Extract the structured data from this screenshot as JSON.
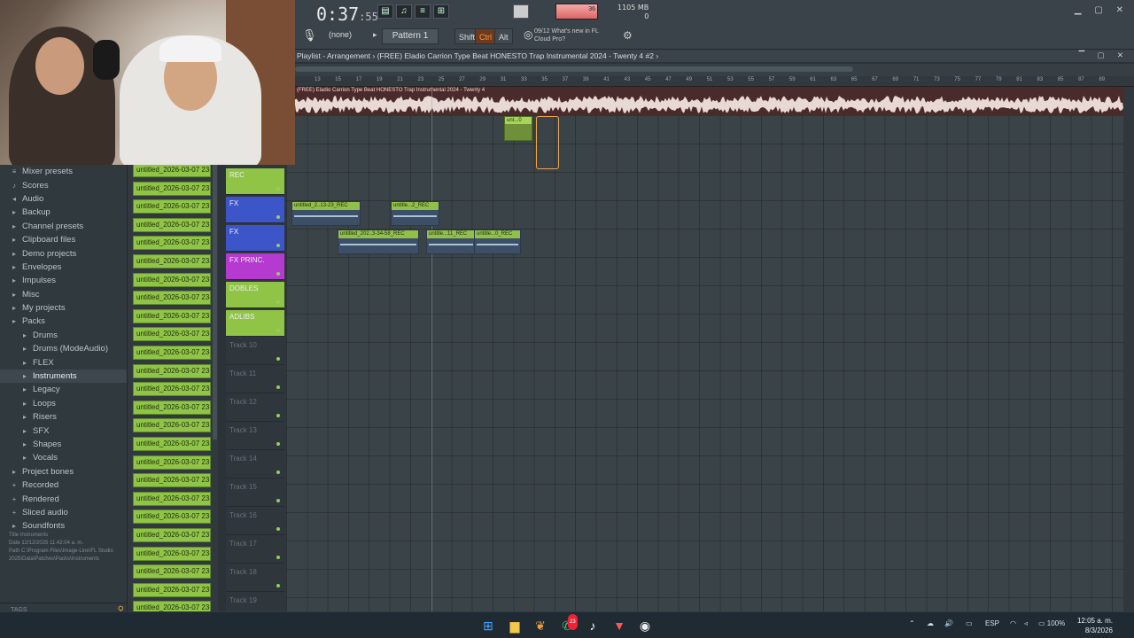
{
  "topbar": {
    "time_main": "0:37",
    "time_sub": ":55",
    "time_unit_label": "M:S:CS",
    "cpu_line1": "1105 MB",
    "cpu_line2": "0",
    "meter_value": "36",
    "pattern_selector": "(none)",
    "pattern_label": "Pattern 1",
    "mod_shift": "Shift",
    "mod_ctrl": "Ctrl",
    "mod_alt": "Alt",
    "news_line1": "09/12  What's new in FL",
    "news_line2": "Cloud Pro?"
  },
  "playlist": {
    "title": "Playlist - Arrangement  › (FREE) Eladio Carrion Type Beat  HONESTO  Trap Instrumental 2024 - Twenty 4 #2  ›",
    "audio_track_label": "(FREE) Eladio Carrion Type Beat  HONESTO  Trap Instrumental 2024 - Twenty 4",
    "ruler": [
      "13",
      "15",
      "17",
      "19",
      "21",
      "23",
      "25",
      "27",
      "29",
      "31",
      "33",
      "35",
      "37",
      "39",
      "41",
      "43",
      "45",
      "47",
      "49",
      "51",
      "53",
      "55",
      "57",
      "59",
      "61",
      "63",
      "65",
      "67",
      "69",
      "71",
      "73",
      "75",
      "77",
      "79",
      "81",
      "83",
      "85",
      "87",
      "89"
    ]
  },
  "clips": [
    {
      "label": "unt...0",
      "color": "green"
    },
    {
      "label": "untitled_2..13-23_REC"
    },
    {
      "label": "untitle...2_REC"
    },
    {
      "label": "untitled_202..3-34-58_REC"
    },
    {
      "label": "untitle...11_REC"
    },
    {
      "label": "untitle...0_REC"
    }
  ],
  "browser": {
    "items": [
      {
        "label": "Mixer presets",
        "icon": "mixer-icon"
      },
      {
        "label": "Scores",
        "icon": "note-icon"
      },
      {
        "label": "Audio",
        "icon": "speaker-icon"
      },
      {
        "label": "Backup",
        "icon": "folder-icon"
      },
      {
        "label": "Channel presets",
        "icon": "folder-icon"
      },
      {
        "label": "Clipboard files",
        "icon": "folder-icon"
      },
      {
        "label": "Demo projects",
        "icon": "folder-icon"
      },
      {
        "label": "Envelopes",
        "icon": "folder-icon"
      },
      {
        "label": "Impulses",
        "icon": "folder-icon"
      },
      {
        "label": "Misc",
        "icon": "folder-icon"
      },
      {
        "label": "My projects",
        "icon": "folder-icon"
      },
      {
        "label": "Packs",
        "icon": "folder-icon"
      },
      {
        "label": "Drums",
        "icon": "folder-icon"
      },
      {
        "label": "Drums (ModeAudio)",
        "icon": "folder-icon"
      },
      {
        "label": "FLEX",
        "icon": "folder-icon"
      },
      {
        "label": "Instruments",
        "icon": "folder-icon"
      },
      {
        "label": "Legacy",
        "icon": "folder-icon"
      },
      {
        "label": "Loops",
        "icon": "folder-icon"
      },
      {
        "label": "Risers",
        "icon": "folder-icon"
      },
      {
        "label": "SFX",
        "icon": "folder-icon"
      },
      {
        "label": "Shapes",
        "icon": "folder-icon"
      },
      {
        "label": "Vocals",
        "icon": "folder-icon"
      },
      {
        "label": "Project bones",
        "icon": "folder-icon"
      },
      {
        "label": "Recorded",
        "icon": "plus-icon"
      },
      {
        "label": "Rendered",
        "icon": "plus-icon"
      },
      {
        "label": "Sliced audio",
        "icon": "plus-icon"
      },
      {
        "label": "Soundfonts",
        "icon": "folder-icon"
      }
    ],
    "info_title": "Title    Instruments",
    "info_date": "Date    12/12/2025 11:42:04 a. m.",
    "info_path": "Path    C:\\Program Files\\Image-Line\\FL Studio 2025\\Data\\Patches\\Packs\\Instruments",
    "tags_label": "TAGS"
  },
  "channels": {
    "item_label": "untitled_2026-03-07 23-"
  },
  "tracks": [
    {
      "name": "REC",
      "color": "#8fc447"
    },
    {
      "name": "FX",
      "color": "#3c55c9"
    },
    {
      "name": "FX",
      "color": "#3c55c9"
    },
    {
      "name": "FX PRINC.",
      "color": "#b43ad0"
    },
    {
      "name": "DOBLES",
      "color": "#8fc447"
    },
    {
      "name": "ADLIBS",
      "color": "#8fc447"
    },
    {
      "name": "Track 10"
    },
    {
      "name": "Track 11"
    },
    {
      "name": "Track 12"
    },
    {
      "name": "Track 13"
    },
    {
      "name": "Track 14"
    },
    {
      "name": "Track 15"
    },
    {
      "name": "Track 16"
    },
    {
      "name": "Track 17"
    },
    {
      "name": "Track 18"
    },
    {
      "name": "Track 19"
    }
  ],
  "taskbar": {
    "lang": "ESP",
    "battery": "100%",
    "time": "12:05 a. m.",
    "date": "8/3/2026",
    "whatsapp_badge": "23"
  }
}
